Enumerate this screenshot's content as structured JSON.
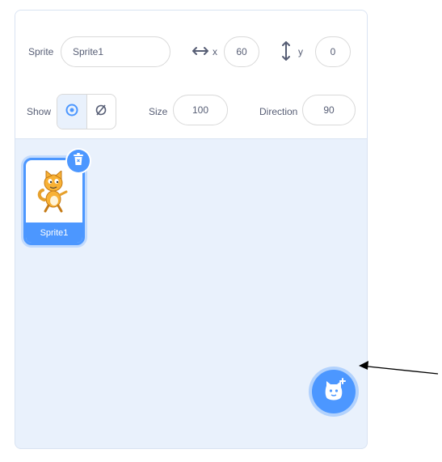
{
  "sprite_info": {
    "sprite_label": "Sprite",
    "sprite_name": "Sprite1",
    "x_label": "x",
    "x_value": "60",
    "y_label": "y",
    "y_value": "0",
    "show_label": "Show",
    "size_label": "Size",
    "size_value": "100",
    "direction_label": "Direction",
    "direction_value": "90"
  },
  "sprite_list": {
    "items": [
      {
        "name": "Sprite1",
        "selected": true
      }
    ]
  },
  "icons": {
    "x_arrows": "horizontal-arrows-icon",
    "y_arrows": "vertical-arrows-icon",
    "show_visible": "eye-icon",
    "show_hidden": "hidden-icon",
    "delete": "trash-icon",
    "add_sprite": "add-sprite-icon",
    "annotation": "annotation-arrow"
  },
  "colors": {
    "accent": "#4c97ff",
    "pane_bg": "#e9f1fc",
    "text": "#575e75"
  }
}
